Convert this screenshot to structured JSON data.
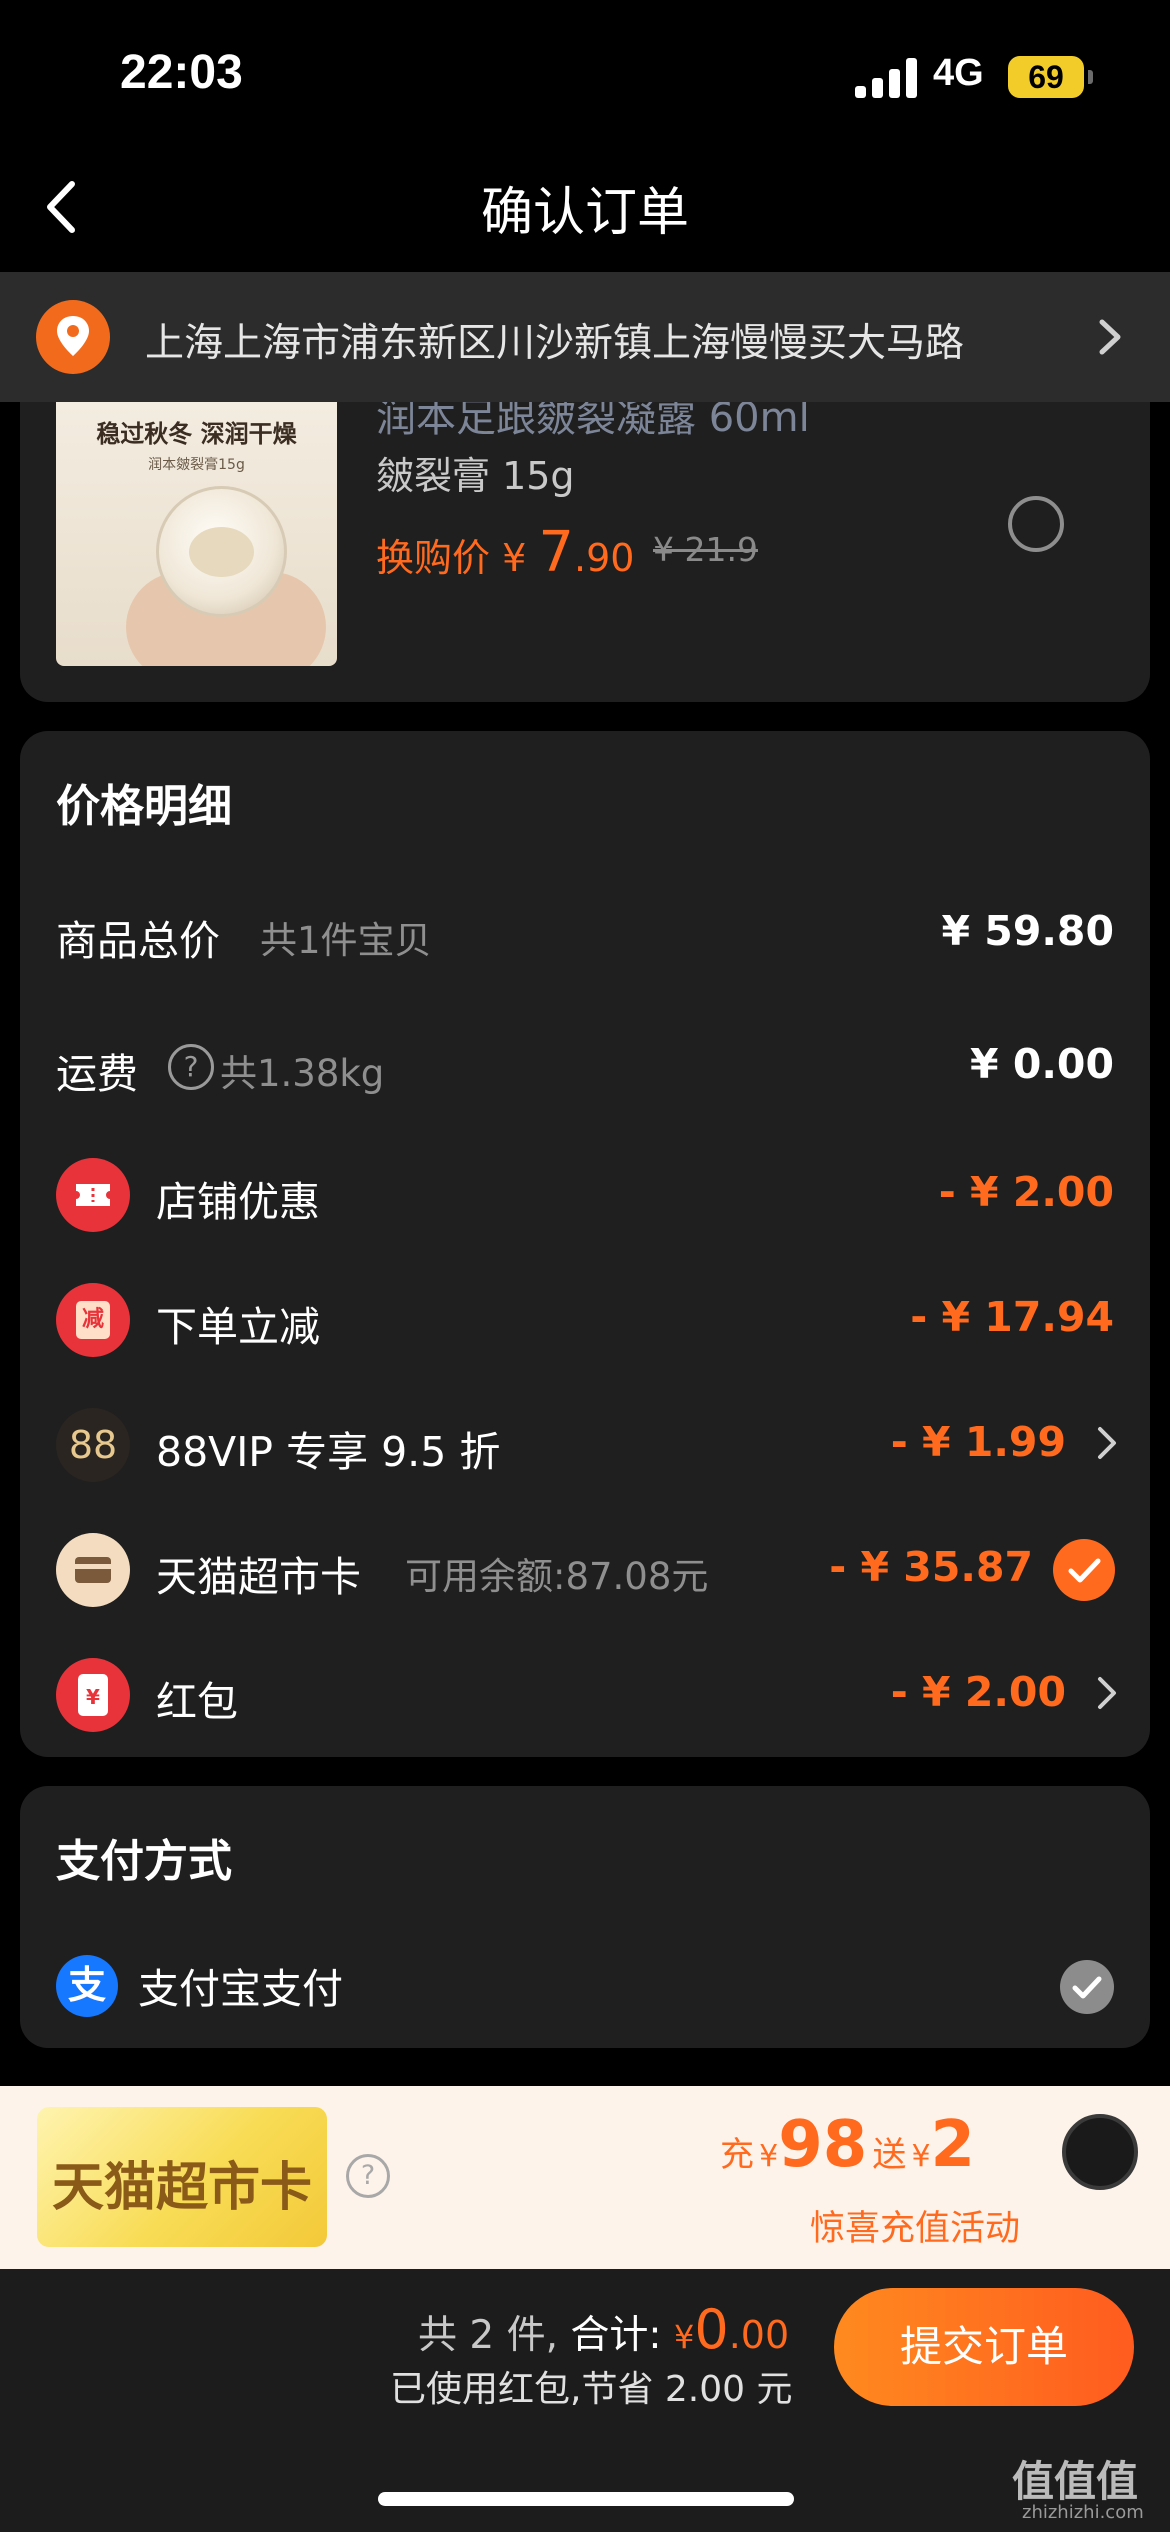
{
  "status": {
    "time": "22:03",
    "network": "4G",
    "battery": "69"
  },
  "nav": {
    "title": "确认订单"
  },
  "address": {
    "text": "上海上海市浦东新区川沙新镇上海慢慢买大马路"
  },
  "product": {
    "name_cut": "润本足跟皴裂凝露 60ml",
    "spec": "皴裂膏 15g",
    "image_text": {
      "headline": "稳过秋冬 深润干燥",
      "sub": "润本皴裂膏15g"
    },
    "swap_label": "换购价",
    "swap_currency": "¥",
    "swap_price_int": "7",
    "swap_price_dec": ".90",
    "original_price": "¥ 21.9",
    "selected": false
  },
  "price_detail": {
    "title": "价格明细",
    "goods_total": {
      "label": "商品总价",
      "sub": "共1件宝贝",
      "value": "¥ 59.80"
    },
    "shipping": {
      "label": "运费",
      "help_icon": "?",
      "sub": "共1.38kg",
      "value": "¥ 0.00"
    },
    "store_discount": {
      "label": "店铺优惠",
      "value": "- ¥ 2.00"
    },
    "order_reduction": {
      "label": "下单立减",
      "icon_text": "减",
      "value": "- ¥ 17.94"
    },
    "vip": {
      "icon_text": "88",
      "label": "88VIP 专享 9.5 折",
      "value": "- ¥ 1.99"
    },
    "tmall_card": {
      "label": "天猫超市卡",
      "sub": "可用余额:87.08元",
      "value": "- ¥ 35.87",
      "checked": true
    },
    "red_packet": {
      "label": "红包",
      "icon_text": "¥",
      "value": "- ¥ 2.00"
    }
  },
  "payment": {
    "title": "支付方式",
    "method": "支付宝支付",
    "icon_text": "支",
    "selected": true
  },
  "promo": {
    "card_name": "天猫超市卡",
    "help_icon": "?",
    "recharge_label": "充",
    "recharge_currency": "¥",
    "recharge_amount": "98",
    "bonus_label": "送",
    "bonus_currency": "¥",
    "bonus_amount": "2",
    "subtitle": "惊喜充值活动"
  },
  "footer": {
    "count": "共 2 件,",
    "total_label": "合计:",
    "total_currency": "¥",
    "total_int": "0",
    "total_dec": ".00",
    "saved": "已使用红包,节省 2.00 元",
    "submit": "提交订单"
  },
  "watermark": {
    "text": "值值值",
    "sub": "zhizhizhi.com"
  },
  "colors": {
    "accent": "#ff6a1f",
    "card": "#1f1f1f",
    "background": "#000000",
    "alipay": "#1677ff",
    "battery": "#f2cd29"
  },
  "icons": [
    "back-icon",
    "location-icon",
    "chevron-right-icon",
    "question-icon",
    "coupon-icon",
    "reduce-icon",
    "vip-icon",
    "card-icon",
    "check-icon",
    "red-packet-icon",
    "alipay-icon"
  ]
}
